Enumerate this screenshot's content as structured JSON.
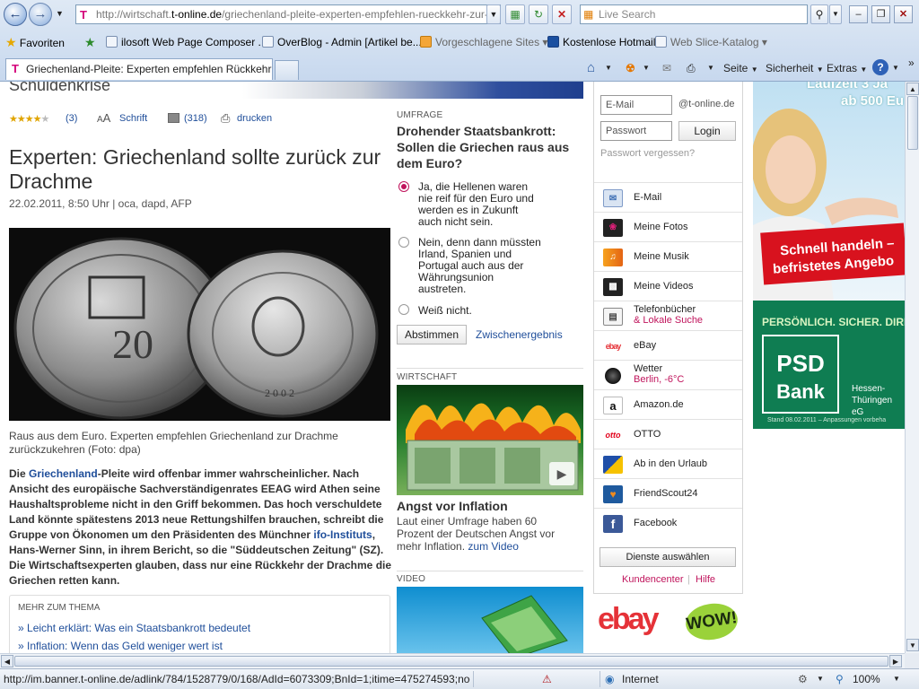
{
  "browser": {
    "url_prefix": "http://wirtschaft.",
    "url_domain": "t-online.de",
    "url_path": "/griechenland-pleite-experten-empfehlen-rueckkehr-zur-drach",
    "search_placeholder": "Live Search",
    "favorites_label": "Favoriten",
    "favorites": [
      "ilosoft Web Page Composer ...",
      "OverBlog - Admin [Artikel be...",
      "Vorgeschlagene Sites",
      "Kostenlose Hotmail",
      "Web Slice-Katalog"
    ],
    "tab_title": "Griechenland-Pleite: Experten empfehlen Rückkehr zu...",
    "commands": {
      "page": "Seite",
      "security": "Sicherheit",
      "extras": "Extras"
    },
    "status_url": "http://im.banner.t-online.de/adlink/784/1528779/0/168/AdId=6073309;BnId=1;itime=475274593;nodecode",
    "status_zone": "Internet",
    "zoom": "100%"
  },
  "article": {
    "header_partial": "Schuldenkrise",
    "rating_count": "(3)",
    "font_label": "Schrift",
    "comments_count": "(318)",
    "print_label": "drucken",
    "headline": "Experten: Griechenland sollte zurück zur Drachme",
    "dateline": "22.02.2011, 8:50 Uhr | oca, dapd, AFP",
    "caption": "Raus aus dem Euro. Experten empfehlen Griechenland zur Drachme zurückzukehren (Foto: dpa)",
    "body_link_1": "Griechenland",
    "body_text_1": "-Pleite wird offenbar immer wahrscheinlicher. Nach Ansicht des europäische Sachverständigenrates EEAG wird Athen seine Haushaltsprobleme nicht in den Griff bekommen. Das hoch verschuldete Land könnte spätestens 2013 neue Rettungshilfen brauchen, schreibt die Gruppe von Ökonomen um den Präsidenten des Münchner ",
    "body_intro": "Die ",
    "body_link_2": "ifo-Instituts",
    "body_text_2": ", Hans-Werner Sinn, in ihrem Bericht, so die \"Süddeutschen Zeitung\" (SZ). Die Wirtschaftsexperten glauben, dass nur eine Rückkehr der Drachme die Griechen retten kann.",
    "more_title": "MEHR ZUM THEMA",
    "more_links": [
      "Leicht erklärt: Was ein Staatsbankrott bedeutet",
      "Inflation: Wenn das Geld weniger wert ist"
    ]
  },
  "poll": {
    "section": "UMFRAGE",
    "question": "Drohender Staatsbankrott: Sollen die Griechen raus aus dem Euro?",
    "options": [
      "Ja, die Hellenen waren nie reif für den Euro und werden es in Zukunft auch nicht sein.",
      "Nein, denn dann müssten Irland, Spanien und Portugal auch aus der Währungsunion austreten.",
      "Weiß nicht."
    ],
    "vote_label": "Abstimmen",
    "results_label": "Zwischenergebnis"
  },
  "economy": {
    "section": "WIRTSCHAFT",
    "title": "Angst vor Inflation",
    "text": "Laut einer Umfrage haben 60 Prozent der Deutschen Angst vor mehr Inflation.",
    "link": "zum Video"
  },
  "video": {
    "section": "VIDEO"
  },
  "login": {
    "email_placeholder": "E-Mail",
    "domain": "@t-online.de",
    "password_placeholder": "Passwort",
    "login_label": "Login",
    "forgot": "Passwort vergessen?"
  },
  "services": [
    {
      "label": "E-Mail",
      "sub": ""
    },
    {
      "label": "Meine Fotos",
      "sub": ""
    },
    {
      "label": "Meine Musik",
      "sub": ""
    },
    {
      "label": "Meine Videos",
      "sub": ""
    },
    {
      "label": "Telefonbücher",
      "sub": "& Lokale Suche"
    },
    {
      "label": "eBay",
      "sub": ""
    },
    {
      "label": "Wetter",
      "sub": "Berlin, -6°C"
    },
    {
      "label": "Amazon.de",
      "sub": ""
    },
    {
      "label": "OTTO",
      "sub": ""
    },
    {
      "label": "Ab in den Urlaub",
      "sub": ""
    },
    {
      "label": "FriendScout24",
      "sub": ""
    },
    {
      "label": "Facebook",
      "sub": ""
    }
  ],
  "services_footer": {
    "choose": "Dienste auswählen",
    "customer": "Kundencenter",
    "help": "Hilfe"
  },
  "ad": {
    "top_line_1": "Laufzeit 3 Ja",
    "top_line_2": "ab 500 Eu",
    "cta_1": "Schnell handeln –",
    "cta_2": "befristetes Angebo",
    "slogan": "PERSÖNLICH. SICHER. DIRE",
    "bank_1": "PSD",
    "bank_2": "Bank",
    "region": "Hessen-Thüringen eG",
    "footnote": "Stand 08.02.2011 – Anpassungen vorbeha",
    "ebay_logo": "ebay",
    "wow_logo": "WOW!"
  },
  "colors": {
    "link": "#1f4e9a",
    "magenta": "#c0145c",
    "poll_accent": "#c0145c"
  }
}
